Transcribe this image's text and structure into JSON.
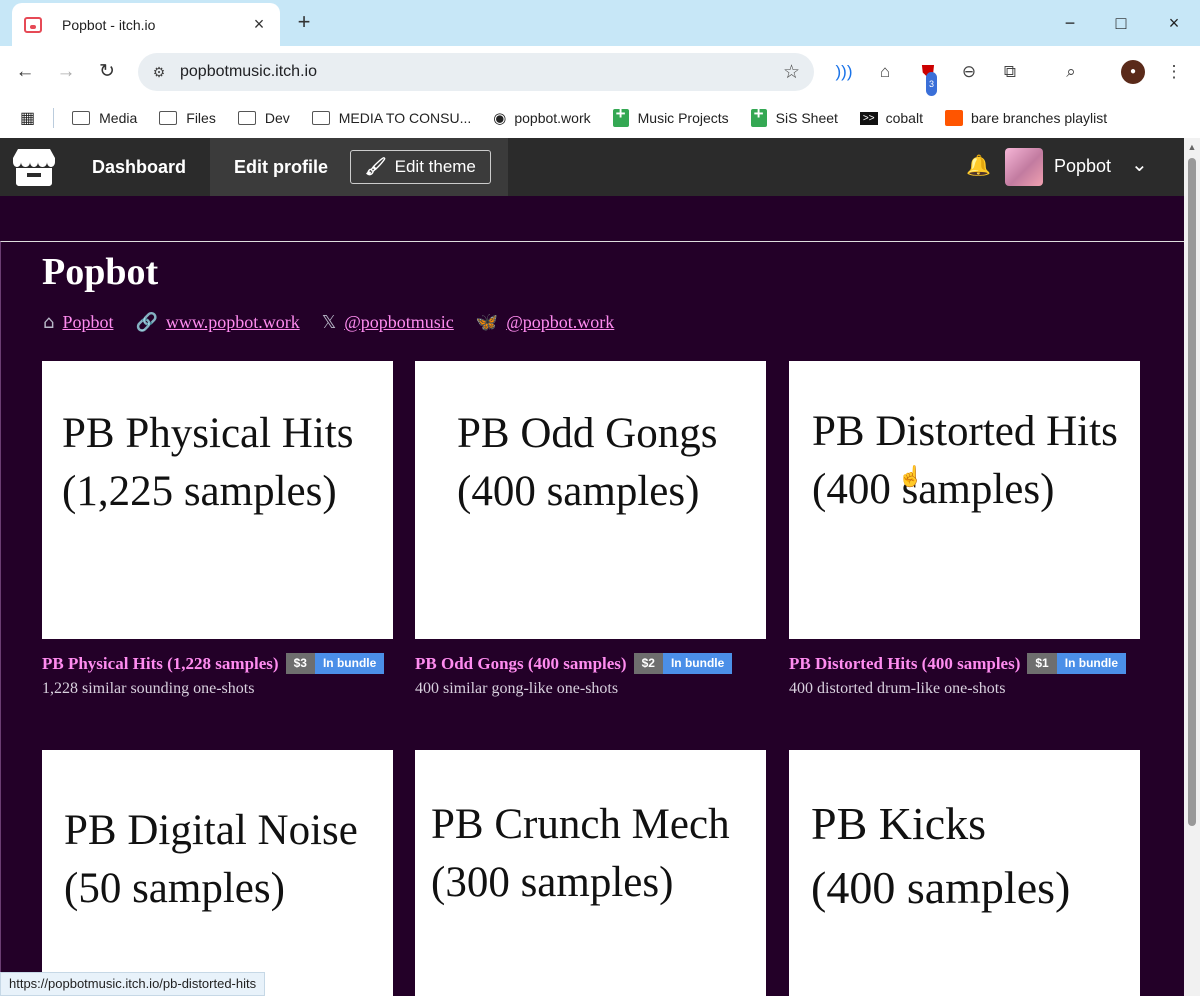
{
  "browser": {
    "tab_title": "Popbot - itch.io",
    "url": "popbotmusic.itch.io",
    "extension_badge": "3",
    "status_url": "https://popbotmusic.itch.io/pb-distorted-hits"
  },
  "bookmarks": [
    {
      "label": "Media",
      "icon": "folder-icon"
    },
    {
      "label": "Files",
      "icon": "folder-icon"
    },
    {
      "label": "Dev",
      "icon": "folder-icon"
    },
    {
      "label": "MEDIA TO CONSU...",
      "icon": "folder-icon"
    },
    {
      "label": "popbot.work",
      "icon": "globe-icon"
    },
    {
      "label": "Music Projects",
      "icon": "sheets-icon"
    },
    {
      "label": "SiS Sheet",
      "icon": "sheets-icon"
    },
    {
      "label": "cobalt",
      "icon": "terminal-icon"
    },
    {
      "label": "bare branches playlist",
      "icon": "soundcloud-icon"
    }
  ],
  "header": {
    "dashboard": "Dashboard",
    "edit_profile": "Edit profile",
    "edit_theme": "Edit theme",
    "username": "Popbot"
  },
  "profile": {
    "name": "Popbot",
    "links": [
      {
        "text": "Popbot",
        "icon": "itch-icon"
      },
      {
        "text": "www.popbot.work",
        "icon": "link-icon"
      },
      {
        "text": "@popbotmusic",
        "icon": "x-icon"
      },
      {
        "text": "@popbot.work",
        "icon": "bluesky-icon"
      }
    ]
  },
  "games": [
    {
      "cover_line1": "PB Physical Hits",
      "cover_line2": "(1,225 samples)",
      "title": "PB Physical Hits (1,228 samples)",
      "price": "$3",
      "bundle": "In bundle",
      "desc": "1,228 similar sounding one-shots"
    },
    {
      "cover_line1": "PB Odd Gongs",
      "cover_line2": "(400 samples)",
      "title": "PB Odd Gongs (400 samples)",
      "price": "$2",
      "bundle": "In bundle",
      "desc": "400 similar gong-like one-shots"
    },
    {
      "cover_line1": "PB Distorted Hits",
      "cover_line2": "(400 samples)",
      "title": "PB Distorted Hits (400 samples)",
      "price": "$1",
      "bundle": "In bundle",
      "desc": "400 distorted drum-like one-shots"
    },
    {
      "cover_line1": "PB Digital Noise",
      "cover_line2": "(50 samples)"
    },
    {
      "cover_line1": "PB Crunch Mech",
      "cover_line2": "(300 samples)"
    },
    {
      "cover_line1": "PB Kicks",
      "cover_line2": "(400 samples)"
    }
  ]
}
